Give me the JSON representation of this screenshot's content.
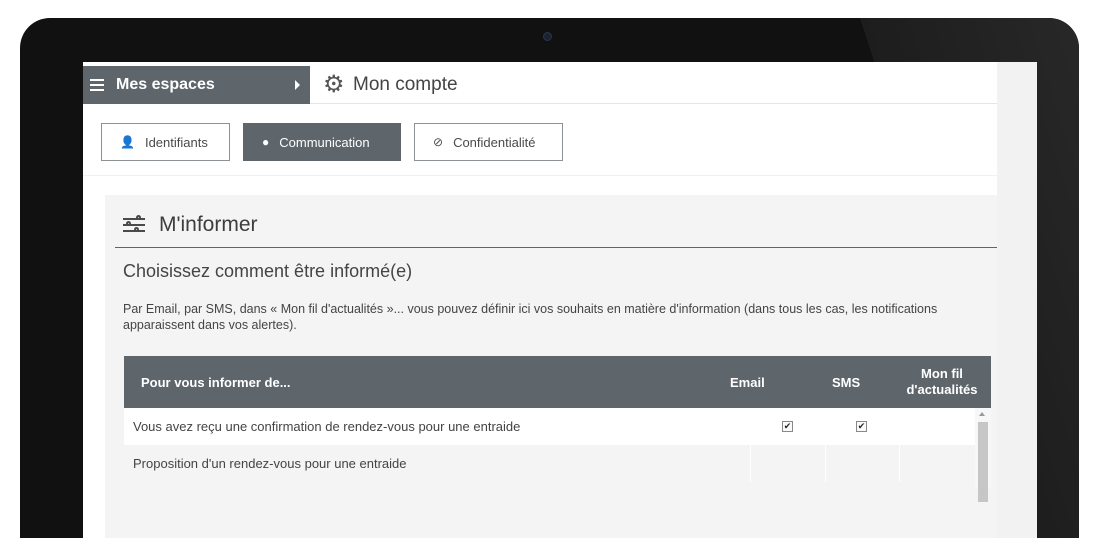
{
  "header": {
    "spaces_label": "Mes espaces",
    "account_title": "Mon compte"
  },
  "tabs": [
    {
      "label": "Identifiants",
      "icon": "user-icon",
      "active": false
    },
    {
      "label": "Communication",
      "icon": "speech-bubble-icon",
      "active": true
    },
    {
      "label": "Confidentialité",
      "icon": "eye-slash-icon",
      "active": false
    }
  ],
  "section": {
    "title": "M'informer",
    "subtitle": "Choisissez comment être informé(e)",
    "description": "Par Email, par SMS, dans « Mon fil d'actualités »... vous pouvez définir ici vos souhaits en matière d'information (dans tous les cas, les notifications apparaissent dans vos alertes)."
  },
  "table": {
    "headers": {
      "topic": "Pour vous informer de...",
      "email": "Email",
      "sms": "SMS",
      "feed": "Mon fil d'actualités"
    },
    "rows": [
      {
        "label": "Vous avez reçu une confirmation de rendez-vous pour une entraide",
        "email": true,
        "sms": true,
        "feed": false
      },
      {
        "label": "Proposition d'un rendez-vous pour une entraide",
        "email": false,
        "sms": false,
        "feed": false
      }
    ]
  },
  "colors": {
    "accent": "#5e656b",
    "background": "#f4f4f4"
  }
}
